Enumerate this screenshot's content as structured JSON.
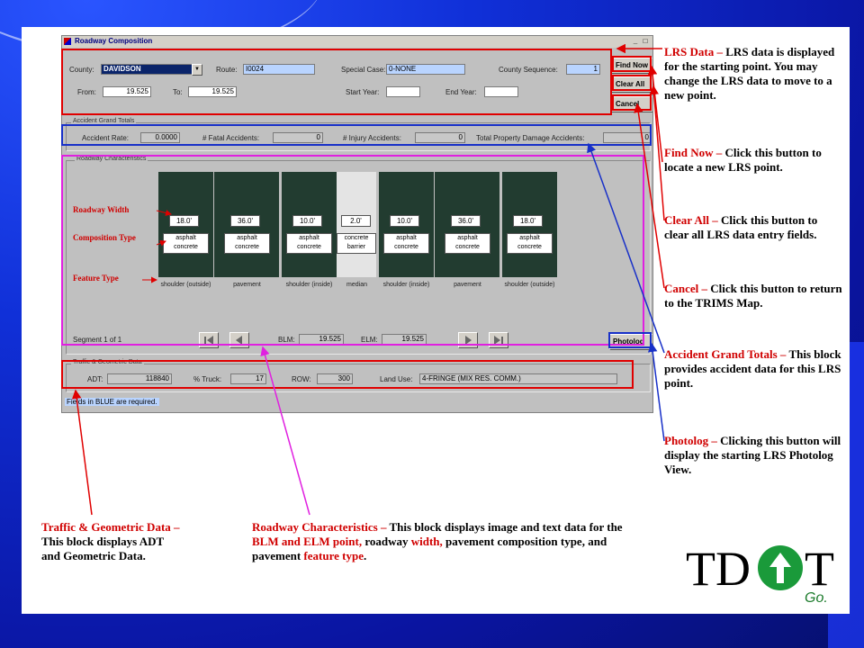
{
  "window": {
    "title": "Roadway Composition",
    "buttons": {
      "find_now": "Find Now",
      "clear_all": "Clear All",
      "cancel": "Cancel",
      "photolog": "Photolog"
    }
  },
  "lrs": {
    "county_label": "County:",
    "county_value": "DAVIDSON",
    "route_label": "Route:",
    "route_value": "I0024",
    "special_case_label": "Special Case:",
    "special_case_value": "0-NONE",
    "county_sequence_label": "County Sequence:",
    "county_sequence_value": "1",
    "from_label": "From:",
    "from_value": "19.525",
    "to_label": "To:",
    "to_value": "19.525",
    "start_year_label": "Start Year:",
    "start_year_value": "",
    "end_year_label": "End Year:",
    "end_year_value": ""
  },
  "accident": {
    "group_title": "Accident Grand Totals",
    "rate_label": "Accident Rate:",
    "rate_value": "0.0000",
    "fatal_label": "# Fatal Accidents:",
    "fatal_value": "0",
    "injury_label": "# Injury Accidents:",
    "injury_value": "0",
    "property_label": "Total Property Damage Accidents:",
    "property_value": "0"
  },
  "roadway": {
    "group_title": "Roadway Characteristics",
    "inner_labels": {
      "width": "Roadway Width",
      "composition": "Composition Type",
      "feature": "Feature Type"
    },
    "segments": [
      {
        "width": "18.0'",
        "composition": "asphalt concrete",
        "feature": "shoulder (outside)"
      },
      {
        "width": "36.0'",
        "composition": "asphalt concrete",
        "feature": "pavement"
      },
      {
        "width": "10.0'",
        "composition": "asphalt concrete",
        "feature": "shoulder (inside)"
      },
      {
        "width": "2.0'",
        "composition": "concrete barrier",
        "feature": "median"
      },
      {
        "width": "10.0'",
        "composition": "asphalt concrete",
        "feature": "shoulder (inside)"
      },
      {
        "width": "36.0'",
        "composition": "asphalt concrete",
        "feature": "pavement"
      },
      {
        "width": "18.0'",
        "composition": "asphalt concrete",
        "feature": "shoulder (outside)"
      }
    ],
    "segment_counter": "Segment 1 of 1",
    "blm_label": "BLM:",
    "blm_value": "19.525",
    "elm_label": "ELM:",
    "elm_value": "19.525"
  },
  "traffic": {
    "group_title": "Traffic & Geometric Data",
    "adt_label": "ADT:",
    "adt_value": "118840",
    "truck_label": "% Truck:",
    "truck_value": "17",
    "row_label": "ROW:",
    "row_value": "300",
    "land_use_label": "Land Use:",
    "land_use_value": "4-FRINGE (MIX RES. COMM.)"
  },
  "status_bar": "Fields in BLUE are required.",
  "callouts": {
    "lrs": {
      "heading": "LRS Data –",
      "body": "LRS data is displayed for the starting point. You may change the LRS data to move to a new point."
    },
    "find_now": {
      "heading": "Find Now –",
      "body": "Click this button to locate a new LRS point."
    },
    "clear_all": {
      "heading": "Clear All –",
      "body": "Click this button to clear all LRS data entry fields."
    },
    "cancel": {
      "heading": "Cancel –",
      "body": "Click this button to return to the TRIMS Map."
    },
    "accident": {
      "heading": "Accident Grand Totals –",
      "body": "This block provides accident data for this LRS point."
    },
    "photolog": {
      "heading": "Photolog –",
      "body": "Clicking this button will display the starting LRS Photolog View."
    },
    "traffic": {
      "heading": "Traffic & Geometric Data –",
      "body": "This block displays ADT and Geometric Data."
    },
    "roadway": {
      "p1": "Roadway Characteristics –",
      "p2": "This block displays image and text data for the",
      "p3": "BLM and ELM point,",
      "p4": "roadway",
      "p5": "width,",
      "p6": "pavement composition type,",
      "p7": "and pavement",
      "p8": "feature type",
      "p9": "."
    }
  },
  "logo": {
    "left": "TD",
    "right": "T",
    "tagline": "Go."
  },
  "colors": {
    "red_box": "#e00000",
    "blue_box": "#1830c8",
    "magenta_box": "#e020e0",
    "blue_field": "#b9d4ff",
    "logo_green": "#1a9a3a"
  }
}
